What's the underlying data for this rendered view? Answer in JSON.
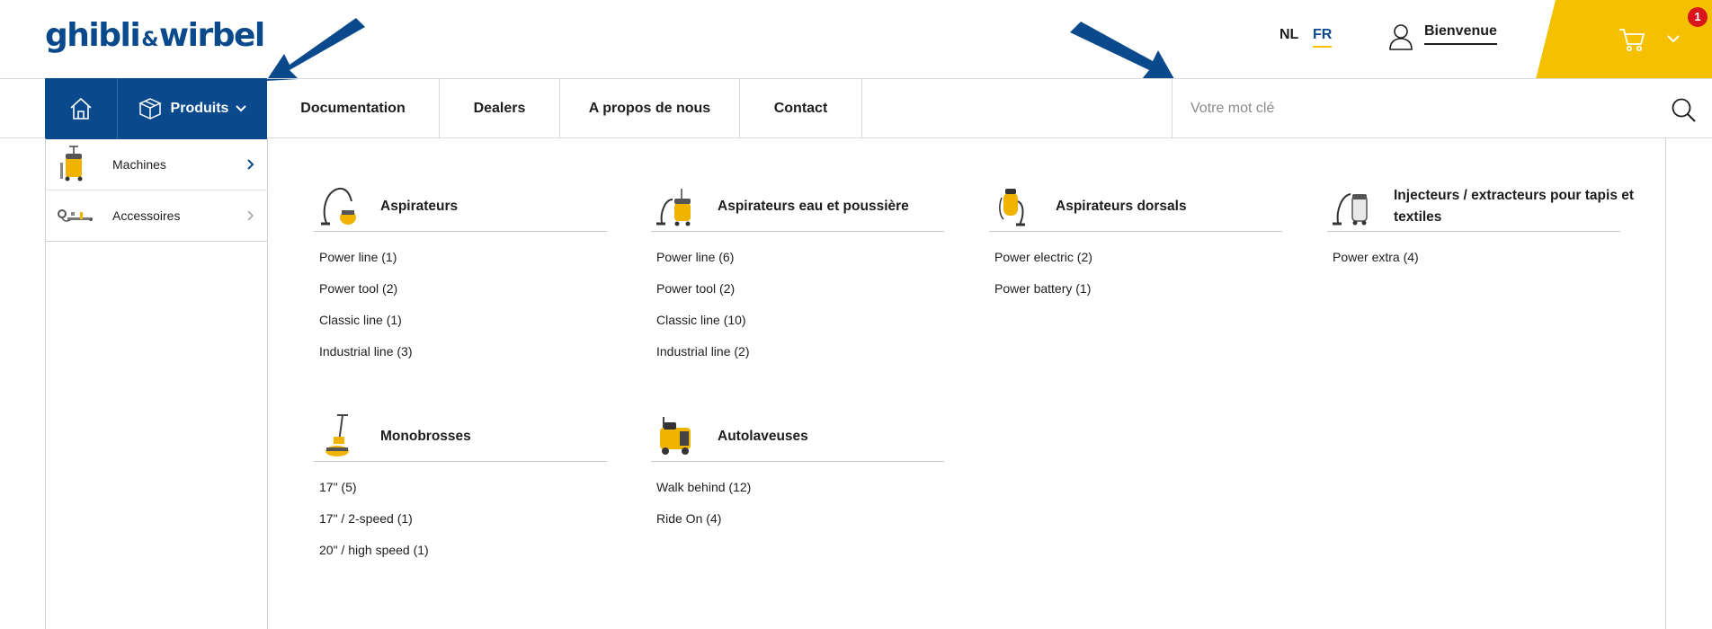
{
  "brand": {
    "logo_part1": "ghibli",
    "logo_amp": "&",
    "logo_part2": "wirbel"
  },
  "header": {
    "lang_nl": "NL",
    "lang_fr": "FR",
    "user_label": "Bienvenue",
    "cart_count": "1"
  },
  "nav": {
    "products": "Produits",
    "documentation": "Documentation",
    "dealers": "Dealers",
    "about": "A propos de nous",
    "contact": "Contact",
    "search_placeholder": "Votre mot clé"
  },
  "sidebar": {
    "items": [
      {
        "label": "Machines"
      },
      {
        "label": "Accessoires"
      }
    ]
  },
  "categories": [
    {
      "title": "Aspirateurs",
      "items": [
        "Power line (1)",
        "Power tool (2)",
        "Classic line (1)",
        "Industrial line (3)"
      ]
    },
    {
      "title": "Aspirateurs eau et poussière",
      "items": [
        "Power line (6)",
        "Power tool (2)",
        "Classic line (10)",
        "Industrial line (2)"
      ]
    },
    {
      "title": "Aspirateurs dorsals",
      "items": [
        "Power electric (2)",
        "Power battery (1)"
      ]
    },
    {
      "title": "Injecteurs / extracteurs pour tapis et textiles",
      "items": [
        "Power extra (4)"
      ]
    },
    {
      "title": "Monobrosses",
      "items": [
        "17\" (5)",
        "17\" / 2-speed (1)",
        "20\" / high speed (1)"
      ]
    },
    {
      "title": "Autolaveuses",
      "items": [
        "Walk behind (12)",
        "Ride On (4)"
      ]
    }
  ],
  "colors": {
    "brand_blue": "#0a4a8c",
    "brand_yellow": "#f4c000",
    "badge_red": "#d8141c"
  }
}
